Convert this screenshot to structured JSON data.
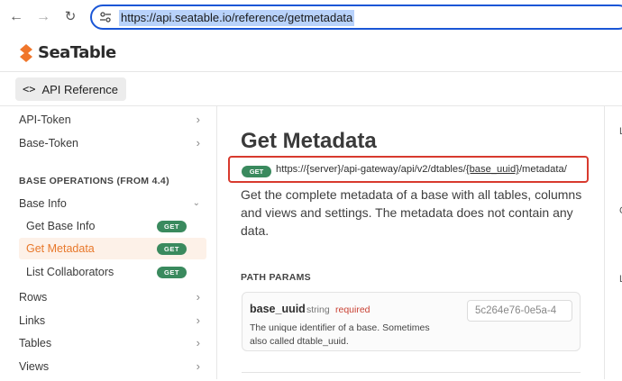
{
  "browser": {
    "url": "https://api.seatable.io/reference/getmetadata",
    "back_icon": "arrow-left-icon",
    "forward_icon": "arrow-right-icon",
    "reload_icon": "reload-icon"
  },
  "header": {
    "logo_text": "SeaTable",
    "brand_color": "#f0762b"
  },
  "apibar": {
    "button_label": "API Reference",
    "button_icon": "code-icon"
  },
  "sidebar": {
    "top_items": [
      {
        "label": "API-Token"
      },
      {
        "label": "Base-Token"
      }
    ],
    "section_title": "BASE OPERATIONS (FROM 4.4)",
    "group_label": "Base Info",
    "sub_items": [
      {
        "label": "Get Base Info",
        "method": "GET"
      },
      {
        "label": "Get Metadata",
        "method": "GET",
        "active": true
      },
      {
        "label": "List Collaborators",
        "method": "GET"
      }
    ],
    "bottom_items": [
      {
        "label": "Rows"
      },
      {
        "label": "Links"
      },
      {
        "label": "Tables"
      },
      {
        "label": "Views"
      }
    ]
  },
  "main": {
    "title": "Get Metadata",
    "method": "GET",
    "url_prefix": "https://{server}/api-gateway/api/v2/dtables/",
    "url_param": "{base_uuid}",
    "url_suffix": "/metadata/",
    "description": "Get the complete metadata of a base with all tables, columns and views and settings. The metadata does not contain any data.",
    "path_params_title": "PATH PARAMS",
    "param": {
      "name": "base_uuid",
      "type": "string",
      "required": "required",
      "description": "The unique identifier of a base. Sometimes also called dtable_uuid.",
      "value": "5c264e76-0e5a-4"
    }
  },
  "right_panel": {
    "letters": [
      "L",
      "C",
      "L"
    ]
  }
}
